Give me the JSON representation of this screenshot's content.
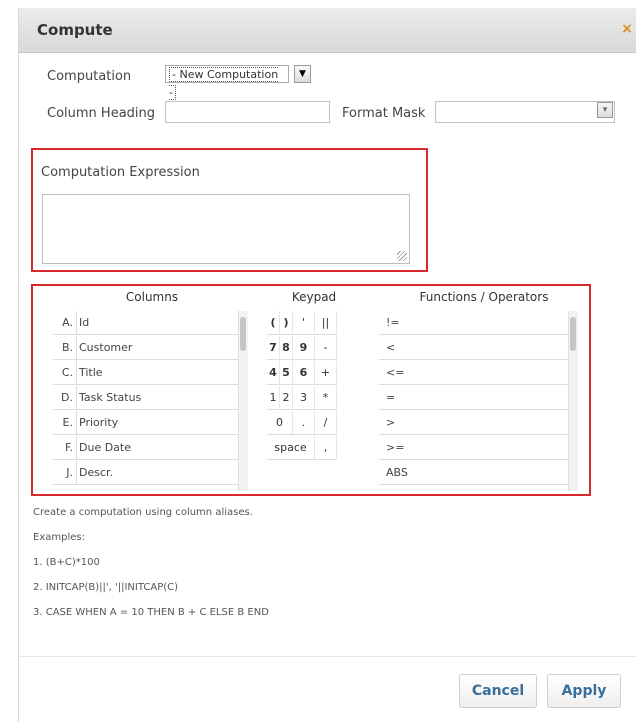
{
  "dialog": {
    "title": "Compute",
    "close_glyph": "×"
  },
  "form": {
    "computation_label": "Computation",
    "computation_value": "- New Computation -",
    "column_heading_label": "Column Heading",
    "column_heading_value": "",
    "format_mask_label": "Format Mask",
    "format_mask_value": ""
  },
  "expression": {
    "label": "Computation Expression",
    "value": ""
  },
  "columns": {
    "header": "Columns",
    "items": [
      {
        "alias": "A.",
        "name": "Id"
      },
      {
        "alias": "B.",
        "name": "Customer"
      },
      {
        "alias": "C.",
        "name": "Title"
      },
      {
        "alias": "D.",
        "name": "Task Status"
      },
      {
        "alias": "E.",
        "name": "Priority"
      },
      {
        "alias": "F.",
        "name": "Due Date"
      },
      {
        "alias": "J.",
        "name": "Descr."
      }
    ]
  },
  "keypad": {
    "header": "Keypad",
    "rows": [
      [
        "(",
        ")",
        "'",
        "||"
      ],
      [
        "7",
        "8",
        "9",
        "-"
      ],
      [
        "4",
        "5",
        "6",
        "+"
      ],
      [
        "1",
        "2",
        "3",
        "*"
      ],
      [
        "0",
        ".",
        "/"
      ],
      [
        "space",
        ","
      ]
    ]
  },
  "functions": {
    "header": "Functions / Operators",
    "items": [
      "!=",
      "<",
      "<=",
      "=",
      ">",
      ">=",
      "ABS"
    ]
  },
  "help": {
    "intro": "Create a computation using column aliases.",
    "examples_label": "Examples:",
    "examples": [
      "1. (B+C)*100",
      "2. INITCAP(B)||', '||INITCAP(C)",
      "3. CASE WHEN A = 10 THEN B + C ELSE B END"
    ]
  },
  "buttons": {
    "cancel": "Cancel",
    "apply": "Apply"
  },
  "colors": {
    "highlight_border": "#d8292f",
    "button_text": "#3a6e9a",
    "close_icon": "#e08a1e"
  }
}
